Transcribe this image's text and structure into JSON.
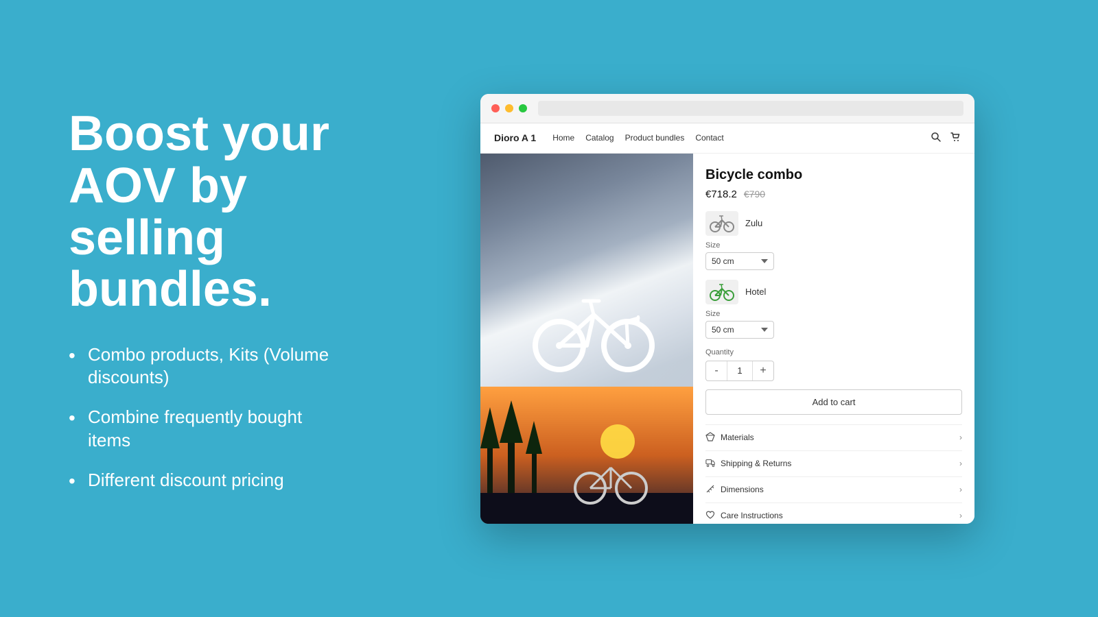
{
  "background_color": "#3aaecc",
  "left": {
    "headline": "Boost your AOV by selling bundles.",
    "bullets": [
      "Combo products, Kits (Volume discounts)",
      "Combine frequently bought items",
      "Different discount pricing"
    ]
  },
  "store": {
    "logo": "Dioro A 1",
    "nav_links": [
      "Home",
      "Catalog",
      "Product bundles",
      "Contact"
    ],
    "product": {
      "title": "Bicycle combo",
      "price_current": "€718.2",
      "price_original": "€790",
      "options": [
        {
          "name": "Zulu",
          "size_label": "Size",
          "size_value": "50 cm"
        },
        {
          "name": "Hotel",
          "size_label": "Size",
          "size_value": "50 cm"
        }
      ],
      "quantity_label": "Quantity",
      "quantity_value": "1",
      "qty_minus": "-",
      "qty_plus": "+",
      "add_to_cart": "Add to cart",
      "accordion_items": [
        {
          "icon": "gem-icon",
          "label": "Materials"
        },
        {
          "icon": "truck-icon",
          "label": "Shipping & Returns"
        },
        {
          "icon": "ruler-icon",
          "label": "Dimensions"
        },
        {
          "icon": "heart-icon",
          "label": "Care Instructions"
        }
      ]
    }
  }
}
